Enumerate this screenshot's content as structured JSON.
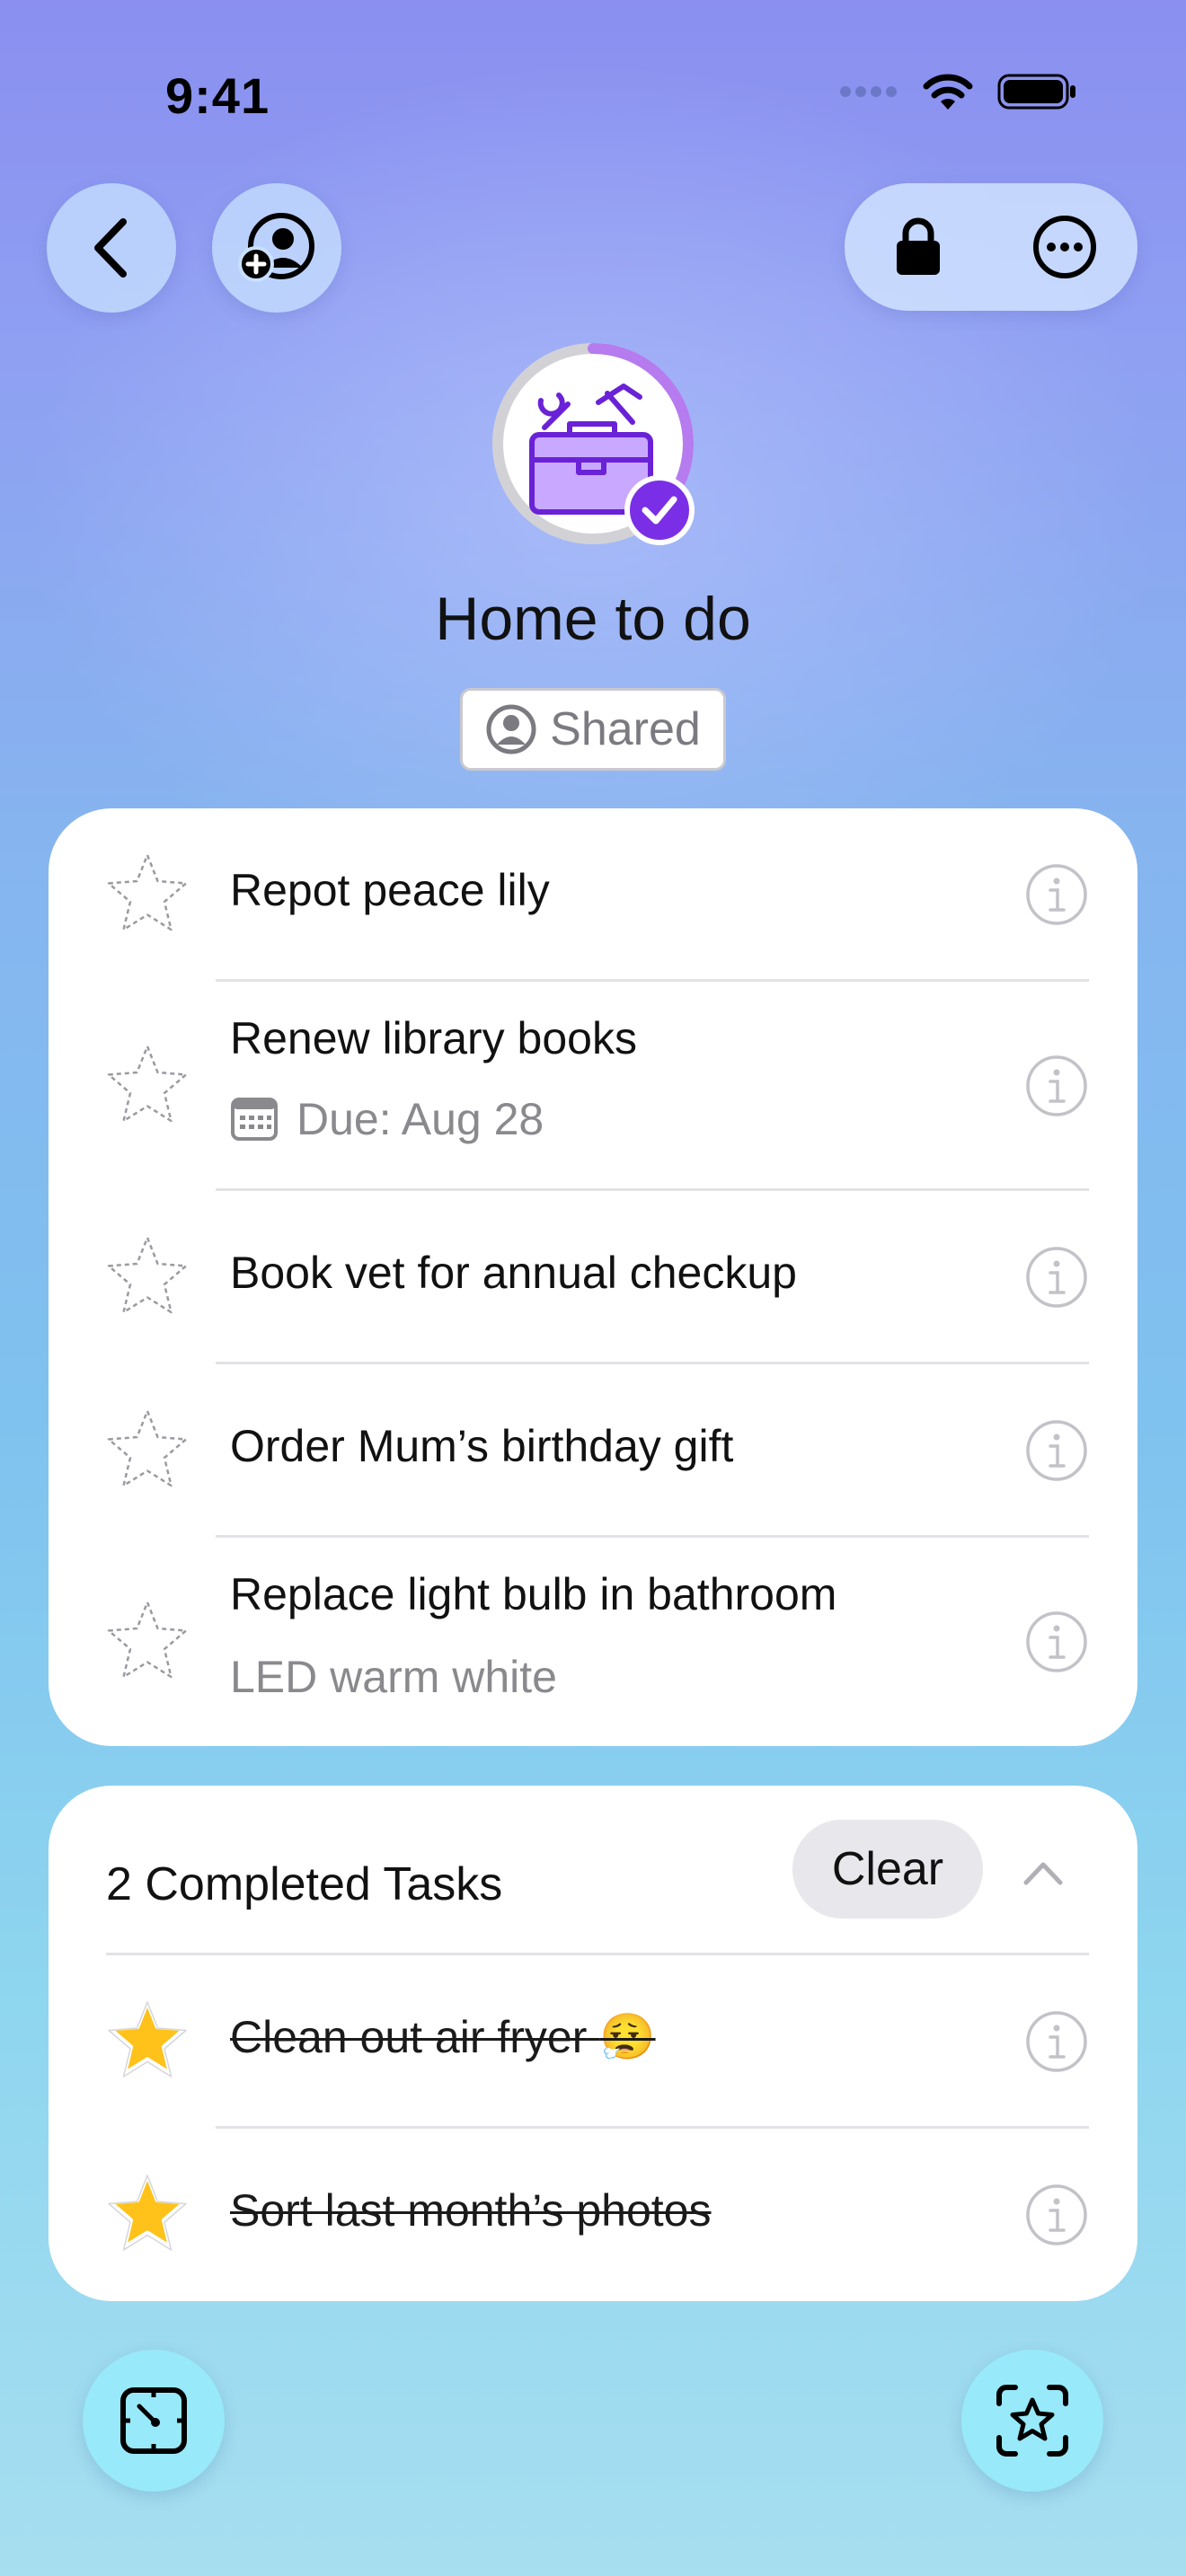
{
  "status_bar": {
    "time": "9:41",
    "icons": [
      "signal-dots-icon",
      "wifi-icon",
      "battery-icon"
    ]
  },
  "nav": {
    "back_icon": "chevron-left-icon",
    "add_person_icon": "person-add-icon",
    "lock_icon": "lock-icon",
    "more_icon": "ellipsis-circle-icon"
  },
  "list": {
    "title": "Home to do",
    "shared_label": "Shared",
    "icon": "toolbox-icon",
    "progress": 0.4,
    "accent_color": "#8a3ff0"
  },
  "tasks": [
    {
      "title": "Repot peace lily",
      "subtitle": ""
    },
    {
      "title": "Renew library books",
      "subtitle": "Due: Aug 28",
      "subtitle_icon": "calendar-icon"
    },
    {
      "title": "Book vet for annual checkup",
      "subtitle": ""
    },
    {
      "title": "Order Mum’s birthday gift",
      "subtitle": ""
    },
    {
      "title": "Replace light bulb in bathroom",
      "subtitle": "LED warm white"
    }
  ],
  "completed": {
    "header": "2 Completed Tasks",
    "clear_label": "Clear",
    "items": [
      {
        "title": "Clean out air fryer",
        "emoji": "😮‍💨"
      },
      {
        "title": "Sort last month’s photos"
      }
    ]
  },
  "bottom_bar": {
    "left_icon": "timer-frame-icon",
    "right_icon": "star-scan-icon"
  },
  "colors": {
    "star_filled": "#ffc21a",
    "star_outline": "#9a9aa0",
    "info_icon": "#c2c2c8",
    "button_bg": "#9fe9f8"
  }
}
